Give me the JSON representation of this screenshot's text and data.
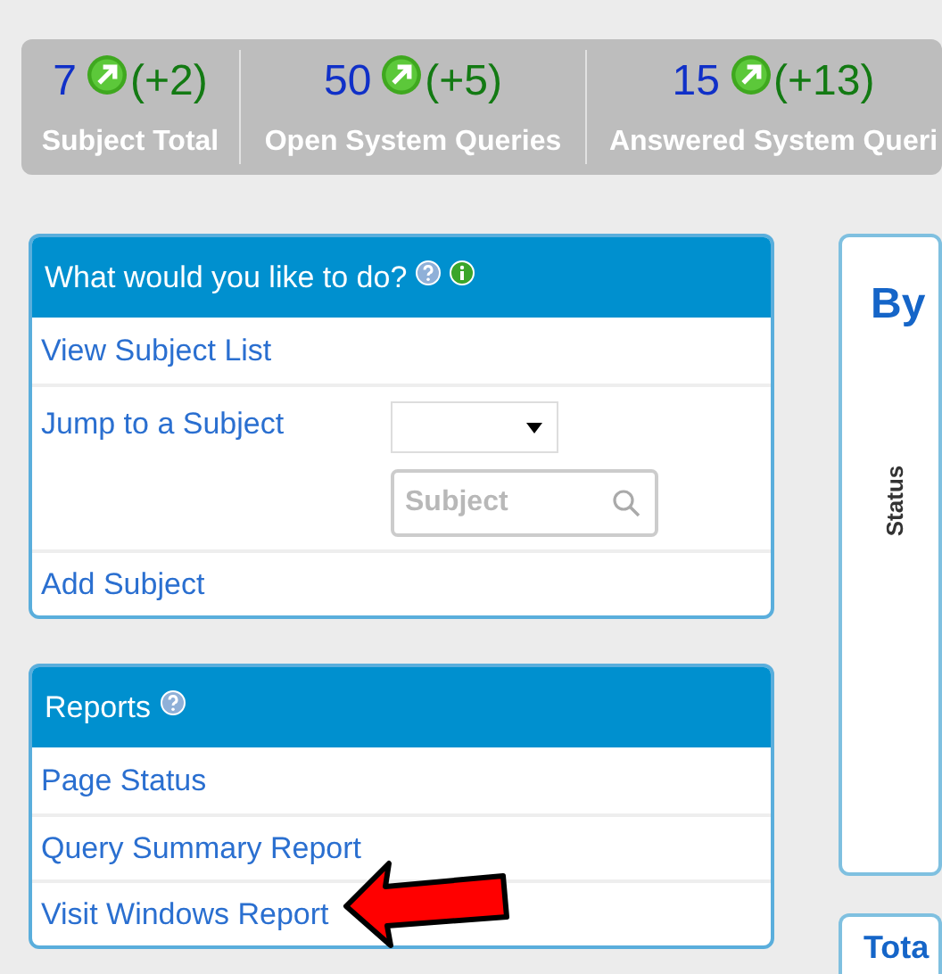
{
  "stats": [
    {
      "value": "7",
      "change": "(+2)",
      "label": "Subject Total"
    },
    {
      "value": "50",
      "change": "(+5)",
      "label": "Open System Queries"
    },
    {
      "value": "15",
      "change": "(+13)",
      "label": "Answered System Queri"
    }
  ],
  "actions_panel": {
    "title": "What would you like to do?",
    "items": [
      {
        "kind": "link",
        "label": "View Subject List"
      },
      {
        "kind": "jump",
        "label": "Jump to a Subject",
        "placeholder": "Subject"
      },
      {
        "kind": "link",
        "label": "Add Subject"
      }
    ]
  },
  "reports_panel": {
    "title": "Reports",
    "items": [
      {
        "kind": "link",
        "label": "Page Status"
      },
      {
        "kind": "link",
        "label": "Query Summary Report"
      },
      {
        "kind": "link",
        "label": "Visit Windows Report"
      }
    ]
  },
  "status_card": {
    "title": "By",
    "axis_label": "Status"
  },
  "totals_card": {
    "title": "Tota"
  }
}
